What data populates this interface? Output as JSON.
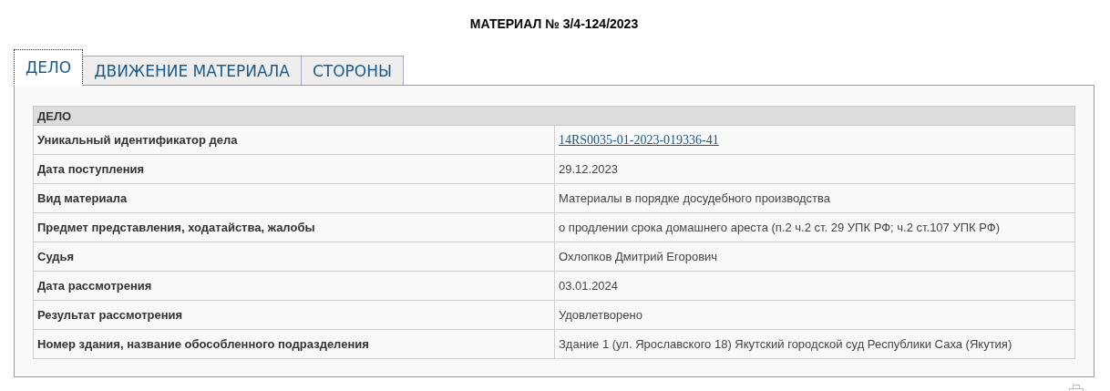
{
  "title": "МАТЕРИАЛ № 3/4-124/2023",
  "tabs": [
    {
      "label": "ДЕЛО",
      "selected": true
    },
    {
      "label": "ДВИЖЕНИЕ МАТЕРИАЛА",
      "selected": false
    },
    {
      "label": "СТОРОНЫ",
      "selected": false
    }
  ],
  "section_title": "ДЕЛО",
  "rows": [
    {
      "label": "Уникальный идентификатор дела",
      "value": "14RS0035-01-2023-019336-41",
      "kind": "link"
    },
    {
      "label": "Дата поступления",
      "value": "29.12.2023",
      "kind": "text"
    },
    {
      "label": "Вид материала",
      "value": "Материалы в порядке досудебного производства",
      "kind": "text"
    },
    {
      "label": "Предмет представления, ходатайства, жалобы",
      "value": "о продлении срока домашнего ареста (п.2 ч.2 ст. 29 УПК РФ; ч.2 ст.107 УПК РФ)",
      "kind": "text"
    },
    {
      "label": "Судья",
      "value": "Охлопков Дмитрий Егорович",
      "kind": "text"
    },
    {
      "label": "Дата рассмотрения",
      "value": "03.01.2024",
      "kind": "text"
    },
    {
      "label": "Результат рассмотрения",
      "value": "Удовлетворено",
      "kind": "text"
    },
    {
      "label": "Номер здания, название обособленного подразделения",
      "value": "Здание 1 (ул. Ярославского 18) Якутский городской суд Республики Саха (Якутия)",
      "kind": "text"
    }
  ]
}
